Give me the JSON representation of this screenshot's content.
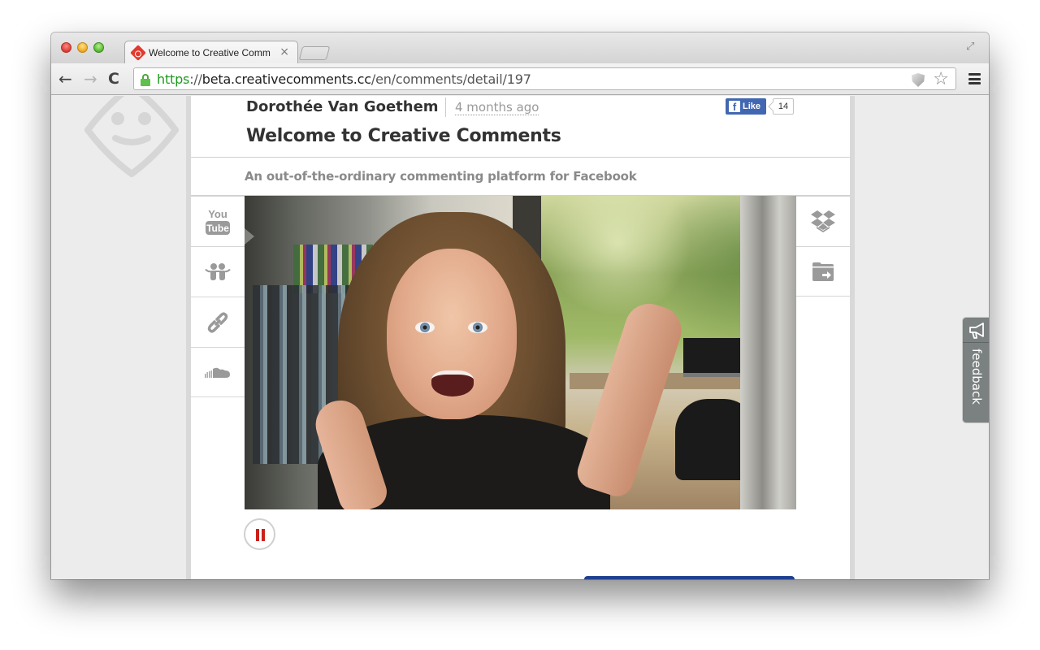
{
  "browser": {
    "tab": {
      "title": "Welcome to Creative Comments",
      "close_label": "×"
    },
    "url": {
      "scheme": "https",
      "separator": "://",
      "host": "beta.creativecomments.cc",
      "path": "/en/comments/detail/197"
    },
    "nav": {
      "back": "←",
      "forward": "→",
      "reload": "C"
    },
    "star": "☆",
    "fullscreen": "⤢"
  },
  "comment": {
    "author": "Dorothée Van Goethem",
    "timestamp": "4 months ago",
    "title": "Welcome to Creative Comments",
    "subtitle": "An out-of-the-ordinary commenting platform for Facebook",
    "facebook": {
      "like_icon": "f",
      "like_label": "Like",
      "like_count": "14"
    }
  },
  "sources_left": [
    {
      "name": "youtube",
      "label_top": "You",
      "label_bottom": "Tube"
    },
    {
      "name": "slideshare"
    },
    {
      "name": "link"
    },
    {
      "name": "soundcloud"
    }
  ],
  "sources_right": [
    {
      "name": "dropbox"
    },
    {
      "name": "file-upload"
    }
  ],
  "player": {
    "state": "playing",
    "pause_label": "Pause"
  },
  "feedback": {
    "label": "feedback"
  },
  "colors": {
    "facebook_blue": "#4267b2",
    "pause_red": "#cc1f1a",
    "url_green": "#1f9a1f",
    "feedback_gray": "#7b8080"
  }
}
